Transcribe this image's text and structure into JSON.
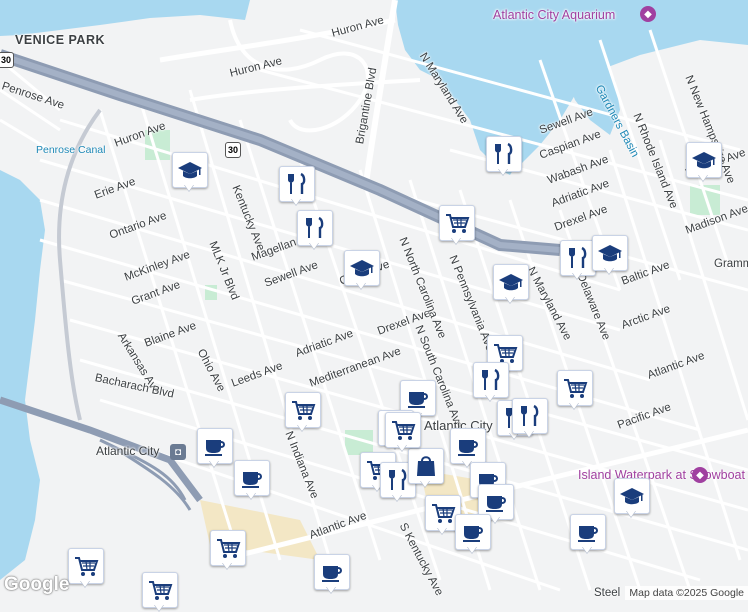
{
  "map": {
    "attribution": "Map data ©2025 Google",
    "logo": "Google",
    "areas": [
      "VENICE PARK"
    ],
    "water_labels": [
      "Penrose Canal",
      "Gardners Basin"
    ],
    "pois": [
      {
        "name": "Atlantic City Aquarium",
        "icon": "aquarium-icon"
      },
      {
        "name": "Island Waterpark at Showboat",
        "icon": "waterpark-icon"
      },
      {
        "name": "Atlantic City",
        "icon": "train-station-icon"
      }
    ],
    "route_shields": [
      "30"
    ],
    "streets": [
      "Huron Ave",
      "Penrose Ave",
      "Erie Ave",
      "Ontario Ave",
      "McKinley Ave",
      "Grant Ave",
      "Arkansas Ave",
      "Blaine Ave",
      "Ohio Ave",
      "Kentucky Ave",
      "MLK Jr Blvd",
      "Magellan Ave",
      "Sewell Ave",
      "Adriatic Ave",
      "Leeds Ave",
      "Bacharach Blvd",
      "Mediterranean Ave",
      "Drexel Ave",
      "N North Carolina Ave",
      "N South Carolina Ave",
      "N Pennsylvania Ave",
      "N Maryland Ave",
      "Brigantine Blvd",
      "Caspian Ave",
      "Wabash Ave",
      "Baltic Ave",
      "Arctic Ave",
      "Atlantic Ave",
      "Pacific Ave",
      "Delaware Ave",
      "Madison Ave",
      "Melrose Ave",
      "N Rhode Island Ave",
      "N New Hampshire Ave",
      "N Indiana Ave",
      "S Kentucky Ave",
      "Gramm",
      "Steel",
      "Atlantic City",
      "Canal Ave"
    ],
    "markers": [
      {
        "type": "school",
        "icon": "graduation-cap-icon"
      },
      {
        "type": "restaurant",
        "icon": "fork-knife-icon"
      },
      {
        "type": "restaurant",
        "icon": "fork-knife-icon"
      },
      {
        "type": "school",
        "icon": "graduation-cap-icon"
      },
      {
        "type": "restaurant",
        "icon": "fork-knife-icon"
      },
      {
        "type": "grocery",
        "icon": "shopping-cart-icon"
      },
      {
        "type": "restaurant",
        "icon": "fork-knife-icon"
      },
      {
        "type": "school",
        "icon": "graduation-cap-icon"
      },
      {
        "type": "school",
        "icon": "graduation-cap-icon"
      },
      {
        "type": "school",
        "icon": "graduation-cap-icon"
      },
      {
        "type": "grocery",
        "icon": "shopping-cart-icon"
      },
      {
        "type": "restaurant",
        "icon": "fork-knife-icon"
      },
      {
        "type": "grocery",
        "icon": "shopping-cart-icon"
      },
      {
        "type": "cafe",
        "icon": "coffee-cup-icon"
      },
      {
        "type": "grocery",
        "icon": "shopping-cart-icon"
      },
      {
        "type": "restaurant",
        "icon": "fork-knife-icon"
      },
      {
        "type": "cafe",
        "icon": "coffee-cup-icon"
      },
      {
        "type": "cafe",
        "icon": "coffee-cup-icon"
      },
      {
        "type": "grocery",
        "icon": "shopping-cart-icon"
      },
      {
        "type": "restaurant",
        "icon": "fork-knife-icon"
      },
      {
        "type": "store",
        "icon": "shopping-bag-icon"
      },
      {
        "type": "cafe",
        "icon": "coffee-cup-icon"
      },
      {
        "type": "cafe",
        "icon": "coffee-cup-icon"
      },
      {
        "type": "grocery",
        "icon": "shopping-cart-icon"
      },
      {
        "type": "cafe",
        "icon": "coffee-cup-icon"
      },
      {
        "type": "grocery",
        "icon": "shopping-cart-icon"
      },
      {
        "type": "cafe",
        "icon": "coffee-cup-icon"
      },
      {
        "type": "cafe",
        "icon": "coffee-cup-icon"
      },
      {
        "type": "cafe",
        "icon": "coffee-cup-icon"
      },
      {
        "type": "school",
        "icon": "graduation-cap-icon"
      },
      {
        "type": "grocery",
        "icon": "shopping-cart-icon"
      },
      {
        "type": "grocery",
        "icon": "shopping-cart-icon"
      },
      {
        "type": "restaurant",
        "icon": "fork-knife-icon"
      },
      {
        "type": "restaurant",
        "icon": "fork-knife-icon"
      },
      {
        "type": "grocery",
        "icon": "shopping-cart-icon"
      }
    ],
    "colors": {
      "water": "#a8d8f0",
      "land": "#f2f3f4",
      "park": "#c8ecd4",
      "highway": "#8e9cb3",
      "road": "#ffffff",
      "marker_icon": "#1a3d7c",
      "beach": "#f3e7c5"
    }
  }
}
